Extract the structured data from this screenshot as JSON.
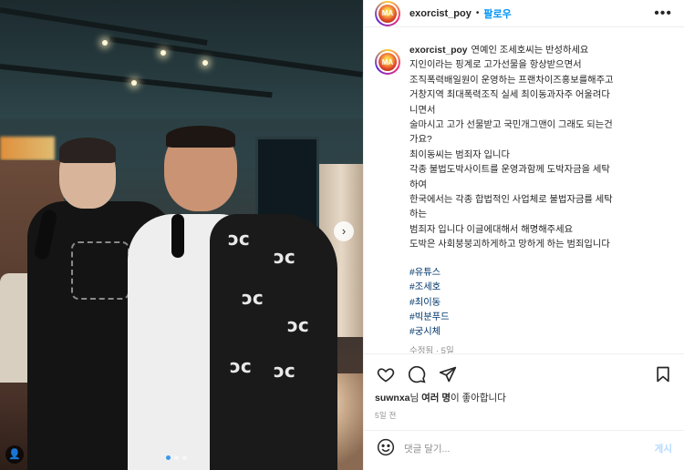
{
  "post": {
    "author": "exorcist_poy",
    "avatar_text": "MA",
    "separator": "•",
    "follow_label": "팔로우",
    "more_label": "•••"
  },
  "photo": {
    "next_label": "›",
    "user_label": "👤",
    "carousel": {
      "count": 3,
      "active_index": 0
    }
  },
  "caption": {
    "username": "exorcist_poy",
    "lines": [
      "연예인 조세호씨는 반성하세요",
      "지인이라는 핑계로 고가선물을 항상받으면서",
      "조직폭력배일원이 운영하는 프랜차이즈홍보를해주고",
      "거창지역 최대폭력조직 실세 최이동과자주 어울려다",
      "니면서",
      "술마시고 고가 선물받고 국민개그맨이 그래도 되는건",
      "가요?",
      "최이동씨는 범죄자 입니다",
      "각종 불법도박사이트를 운영과함께 도박자금을 세탁",
      "하여",
      "한국에서는 각종 합법적인 사업체로 불법자금를 세탁",
      "하는",
      "범죄자 입니다 이글에대해서 해명해주세요",
      "도박은 사회붕붕괴하게하고 망하게 하는 범죄입니다"
    ],
    "tags": [
      "#유튜스",
      "#조세호",
      "#최이동",
      "#빅분푸드",
      "#궁시체"
    ],
    "edited": "수정됨 · 5일"
  },
  "actions": {
    "like_icon": "heart-icon",
    "comment_icon": "comment-icon",
    "share_icon": "send-icon",
    "save_icon": "bookmark-icon"
  },
  "likes": {
    "user": "suwnxa",
    "suffix_1": "님 ",
    "others": "여러 명",
    "suffix_2": "이 좋아합니다"
  },
  "time_ago": "5일 전",
  "comment_box": {
    "emoji_icon": "smiley-icon",
    "placeholder": "댓글 달기...",
    "post_label": "게시"
  },
  "colors": {
    "accent_blue": "#0095f6",
    "hashtag": "#00376b",
    "muted": "#8e8e8e",
    "post_disabled": "#b3dbff"
  }
}
